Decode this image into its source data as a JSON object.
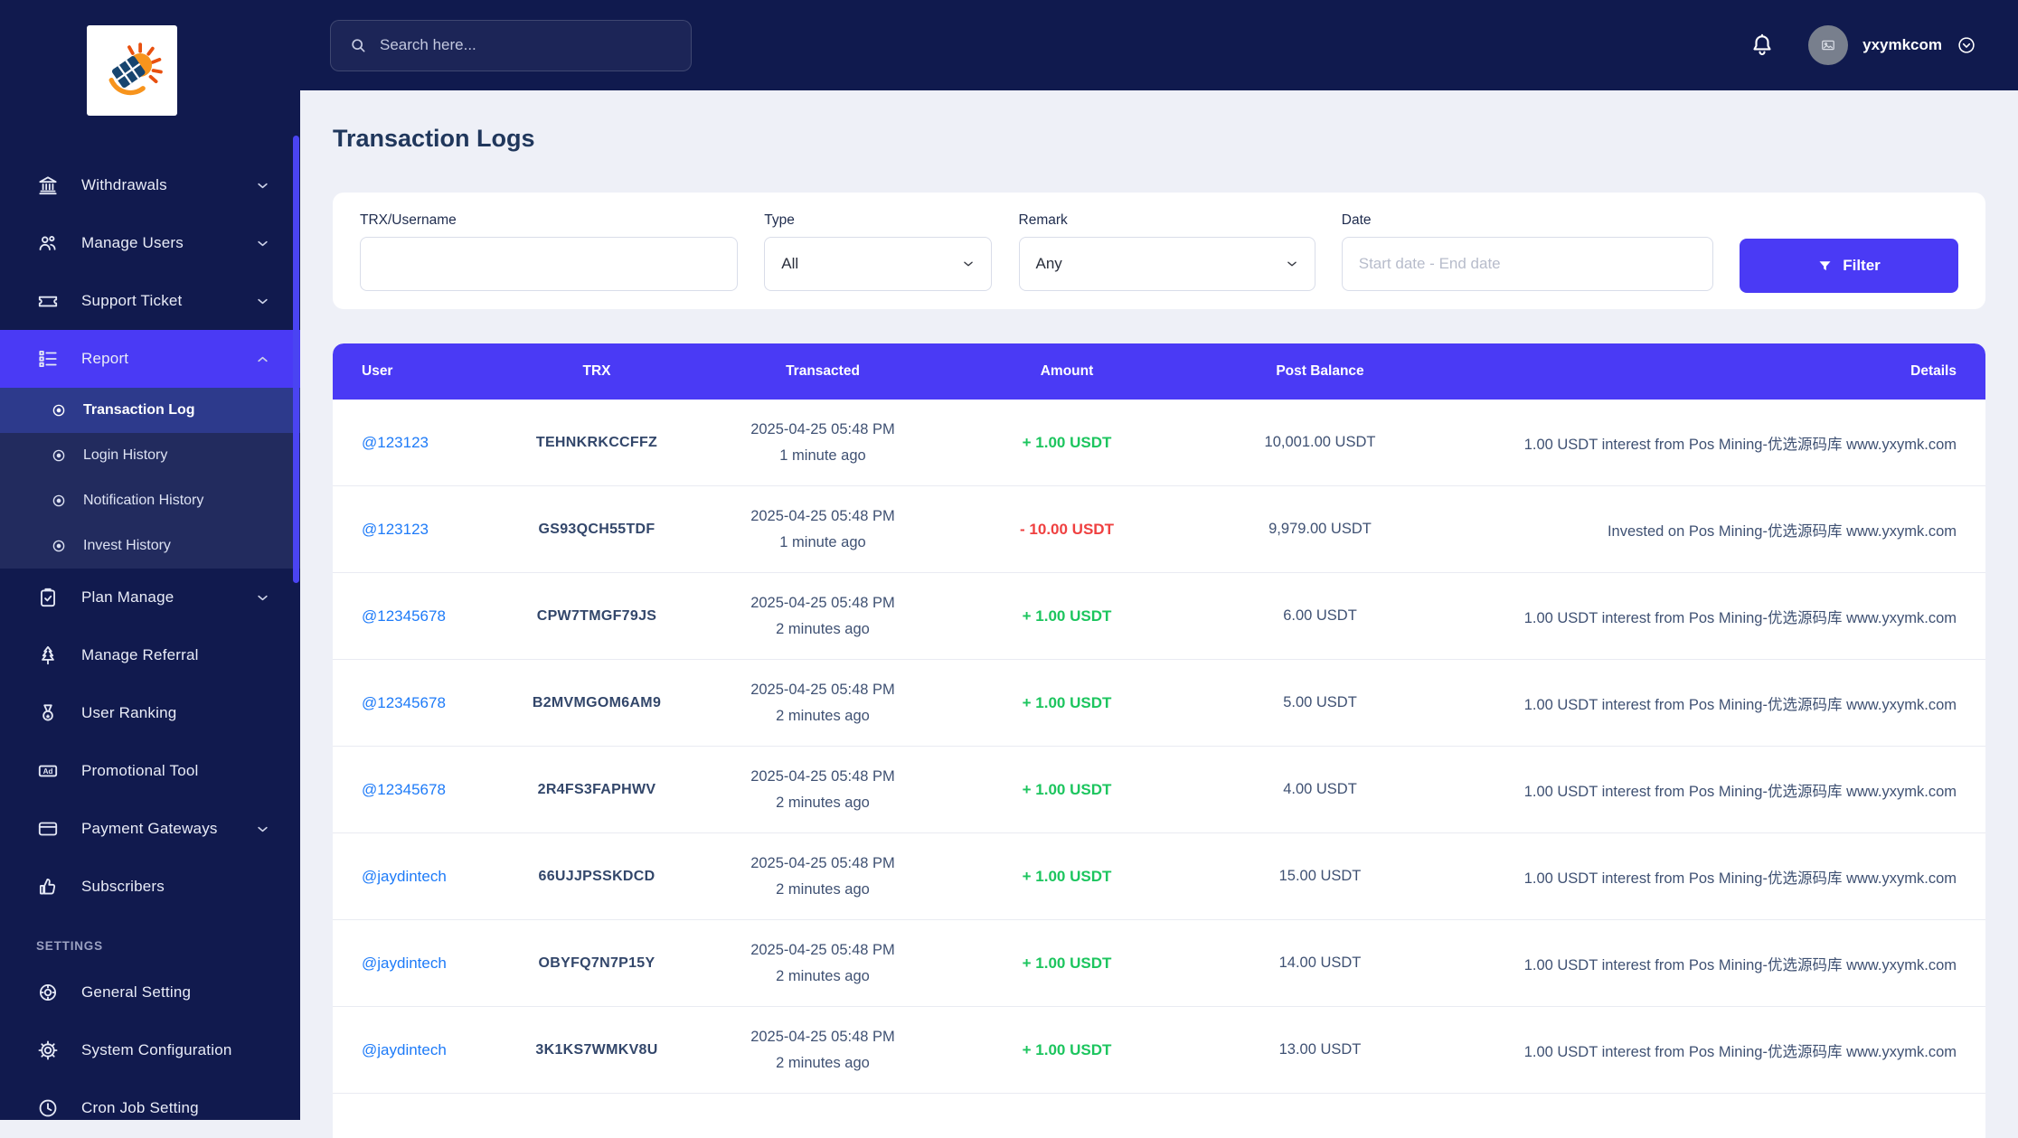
{
  "colors": {
    "accent": "#4a3af5",
    "sidebar_bg": "#111a4e",
    "topbar_bg": "#101a4e",
    "content_bg": "#eef0f7",
    "link_blue": "#1e7bf8",
    "credit_green": "#1cc55e",
    "debit_red": "#ef4040"
  },
  "topbar": {
    "search_placeholder": "Search here...",
    "username": "yxymkcom"
  },
  "sidebar": {
    "items": [
      {
        "label": "Withdrawals",
        "icon": "bank-icon",
        "has_submenu": true
      },
      {
        "label": "Manage Users",
        "icon": "users-icon",
        "has_submenu": true
      },
      {
        "label": "Support Ticket",
        "icon": "ticket-icon",
        "has_submenu": true
      },
      {
        "label": "Report",
        "icon": "report-icon",
        "has_submenu": true,
        "active": true,
        "children": [
          {
            "label": "Transaction Log",
            "active": true
          },
          {
            "label": "Login History"
          },
          {
            "label": "Notification History"
          },
          {
            "label": "Invest History"
          }
        ]
      },
      {
        "label": "Plan Manage",
        "icon": "clipboard-icon",
        "has_submenu": true
      },
      {
        "label": "Manage Referral",
        "icon": "tree-icon"
      },
      {
        "label": "User Ranking",
        "icon": "medal-icon"
      },
      {
        "label": "Promotional Tool",
        "icon": "ad-icon"
      },
      {
        "label": "Payment Gateways",
        "icon": "card-icon",
        "has_submenu": true
      },
      {
        "label": "Subscribers",
        "icon": "thumbs-up-icon"
      }
    ],
    "settings_heading": "SETTINGS",
    "settings_items": [
      {
        "label": "General Setting",
        "icon": "knob-icon"
      },
      {
        "label": "System Configuration",
        "icon": "gear-icon"
      },
      {
        "label": "Cron Job Setting",
        "icon": "clock-icon"
      }
    ]
  },
  "page": {
    "title": "Transaction Logs"
  },
  "filters": {
    "trx_username_label": "TRX/Username",
    "trx_username_value": "",
    "type_label": "Type",
    "type_value": "All",
    "remark_label": "Remark",
    "remark_value": "Any",
    "date_label": "Date",
    "date_placeholder": "Start date - End date",
    "filter_button_label": "Filter"
  },
  "table": {
    "headers": [
      "User",
      "TRX",
      "Transacted",
      "Amount",
      "Post Balance",
      "Details"
    ],
    "rows": [
      {
        "user": "@123123",
        "trx": "TEHNKRKCCFFZ",
        "date": "2025-04-25 05:48 PM",
        "time_ago": "1 minute ago",
        "amount": "+ 1.00 USDT",
        "direction": "credit",
        "post_balance": "10,001.00 USDT",
        "details": "1.00 USDT interest from Pos Mining-优选源码库 www.yxymk.com"
      },
      {
        "user": "@123123",
        "trx": "GS93QCH55TDF",
        "date": "2025-04-25 05:48 PM",
        "time_ago": "1 minute ago",
        "amount": "- 10.00 USDT",
        "direction": "debit",
        "post_balance": "9,979.00 USDT",
        "details": "Invested on Pos Mining-优选源码库 www.yxymk.com"
      },
      {
        "user": "@12345678",
        "trx": "CPW7TMGF79JS",
        "date": "2025-04-25 05:48 PM",
        "time_ago": "2 minutes ago",
        "amount": "+ 1.00 USDT",
        "direction": "credit",
        "post_balance": "6.00 USDT",
        "details": "1.00 USDT interest from Pos Mining-优选源码库 www.yxymk.com"
      },
      {
        "user": "@12345678",
        "trx": "B2MVMGOM6AM9",
        "date": "2025-04-25 05:48 PM",
        "time_ago": "2 minutes ago",
        "amount": "+ 1.00 USDT",
        "direction": "credit",
        "post_balance": "5.00 USDT",
        "details": "1.00 USDT interest from Pos Mining-优选源码库 www.yxymk.com"
      },
      {
        "user": "@12345678",
        "trx": "2R4FS3FAPHWV",
        "date": "2025-04-25 05:48 PM",
        "time_ago": "2 minutes ago",
        "amount": "+ 1.00 USDT",
        "direction": "credit",
        "post_balance": "4.00 USDT",
        "details": "1.00 USDT interest from Pos Mining-优选源码库 www.yxymk.com"
      },
      {
        "user": "@jaydintech",
        "trx": "66UJJPSSKDCD",
        "date": "2025-04-25 05:48 PM",
        "time_ago": "2 minutes ago",
        "amount": "+ 1.00 USDT",
        "direction": "credit",
        "post_balance": "15.00 USDT",
        "details": "1.00 USDT interest from Pos Mining-优选源码库 www.yxymk.com"
      },
      {
        "user": "@jaydintech",
        "trx": "OBYFQ7N7P15Y",
        "date": "2025-04-25 05:48 PM",
        "time_ago": "2 minutes ago",
        "amount": "+ 1.00 USDT",
        "direction": "credit",
        "post_balance": "14.00 USDT",
        "details": "1.00 USDT interest from Pos Mining-优选源码库 www.yxymk.com"
      },
      {
        "user": "@jaydintech",
        "trx": "3K1KS7WMKV8U",
        "date": "2025-04-25 05:48 PM",
        "time_ago": "2 minutes ago",
        "amount": "+ 1.00 USDT",
        "direction": "credit",
        "post_balance": "13.00 USDT",
        "details": "1.00 USDT interest from Pos Mining-优选源码库 www.yxymk.com"
      }
    ]
  }
}
